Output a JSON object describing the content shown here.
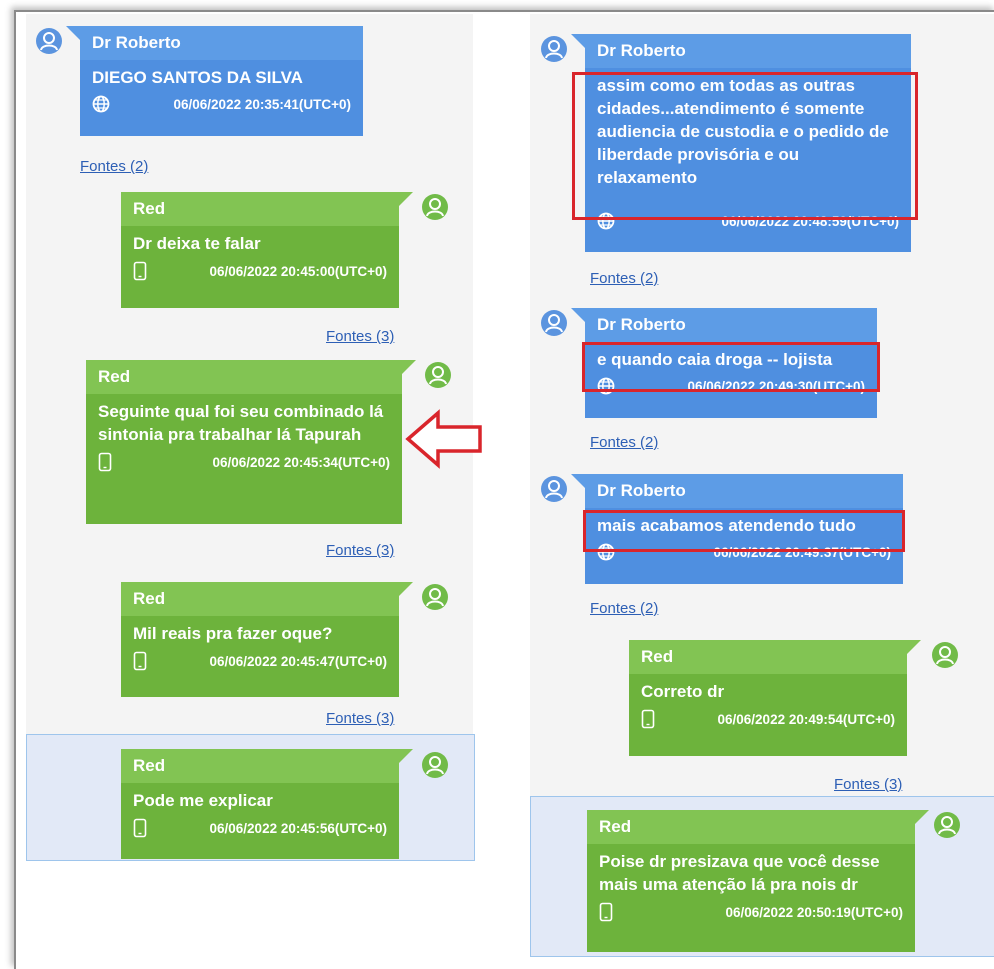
{
  "left": {
    "msg1": {
      "sender": "Dr Roberto",
      "text": "DIEGO SANTOS DA SILVA",
      "time": "06/06/2022 20:35:41(UTC+0)",
      "sources": "Fontes (2)"
    },
    "msg2": {
      "sender": "Red",
      "text": "Dr deixa te falar",
      "time": "06/06/2022 20:45:00(UTC+0)",
      "sources": "Fontes (3)"
    },
    "msg3": {
      "sender": "Red",
      "text": "Seguinte qual foi seu combinado lá sintonia pra trabalhar lá Tapurah",
      "time": "06/06/2022 20:45:34(UTC+0)",
      "sources": "Fontes (3)"
    },
    "msg4": {
      "sender": "Red",
      "text": "Mil reais pra fazer oque?",
      "time": "06/06/2022 20:45:47(UTC+0)",
      "sources": "Fontes (3)"
    },
    "msg5": {
      "sender": "Red",
      "text": "Pode me explicar",
      "time": "06/06/2022 20:45:56(UTC+0)"
    }
  },
  "right": {
    "msg1": {
      "sender": "Dr Roberto",
      "text": "assim como em todas as outras cidades...atendimento é somente audiencia de custodia e o pedido de liberdade provisória e ou relaxamento",
      "time": "06/06/2022 20:48:59(UTC+0)",
      "sources": "Fontes (2)"
    },
    "msg2": {
      "sender": "Dr Roberto",
      "text": "e quando caia droga -- lojista",
      "time": "06/06/2022 20:49:30(UTC+0)",
      "sources": "Fontes (2)"
    },
    "msg3": {
      "sender": "Dr Roberto",
      "text": "mais acabamos atendendo tudo",
      "time": "06/06/2022 20:49:37(UTC+0)",
      "sources": "Fontes (2)"
    },
    "msg4": {
      "sender": "Red",
      "text": "Correto dr",
      "time": "06/06/2022 20:49:54(UTC+0)",
      "sources": "Fontes (3)"
    },
    "msg5": {
      "sender": "Red",
      "text": "Poise dr presizava que você desse mais uma atenção lá pra nois dr",
      "time": "06/06/2022 20:50:19(UTC+0)"
    }
  },
  "icons": {
    "avatar": "user-avatar-icon",
    "web": "globe-icon",
    "phone": "phone-icon",
    "arrow": "red-outline-arrow-left"
  },
  "colors": {
    "blue_bubble": "#4f8fe0",
    "green_bubble": "#6db33c",
    "highlight": "#d9252b",
    "link": "#2d5fb5"
  }
}
